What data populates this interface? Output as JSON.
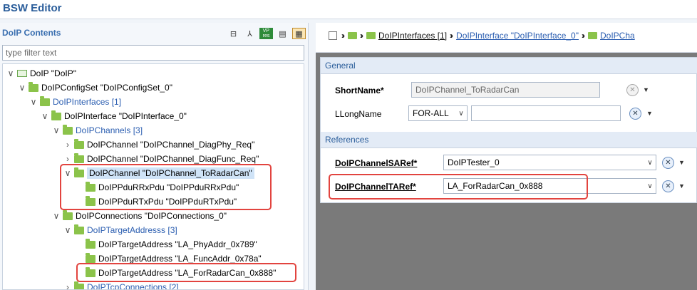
{
  "app": {
    "title": "BSW Editor"
  },
  "left": {
    "header": "DoIP Contents",
    "filter_placeholder": "type filter text",
    "tree": [
      {
        "label": "DoIP \"DoIP\"",
        "link": false
      },
      {
        "label": "DoIPConfigSet \"DoIPConfigSet_0\"",
        "link": false
      },
      {
        "label": "DoIPInterfaces [1]",
        "link": true
      },
      {
        "label": "DoIPInterface \"DoIPInterface_0\"",
        "link": false
      },
      {
        "label": "DoIPChannels [3]",
        "link": true
      },
      {
        "label": "DoIPChannel \"DoIPChannel_DiagPhy_Req\"",
        "link": false
      },
      {
        "label": "DoIPChannel \"DoIPChannel_DiagFunc_Req\"",
        "link": false
      },
      {
        "label": "DoIPChannel \"DoIPChannel_ToRadarCan\"",
        "link": false
      },
      {
        "label": "DoIPPduRRxPdu \"DoIPPduRRxPdu\"",
        "link": false
      },
      {
        "label": "DoIPPduRTxPdu \"DoIPPduRTxPdu\"",
        "link": false
      },
      {
        "label": "DoIPConnections \"DoIPConnections_0\"",
        "link": false
      },
      {
        "label": "DoIPTargetAddresss [3]",
        "link": true
      },
      {
        "label": "DoIPTargetAddress \"LA_PhyAddr_0x789\"",
        "link": false
      },
      {
        "label": "DoIPTargetAddress \"LA_FuncAddr_0x78a\"",
        "link": false
      },
      {
        "label": "DoIPTargetAddress \"LA_ForRadarCan_0x888\"",
        "link": false
      },
      {
        "label": "DoIPTcpConnections [2]",
        "link": true
      }
    ]
  },
  "breadcrumb": {
    "items": [
      "DoIPInterfaces [1]",
      "DoIPInterface \"DoIPInterface_0\"",
      "DoIPCha"
    ]
  },
  "editor": {
    "general": {
      "title": "General",
      "shortname_label": "ShortName*",
      "shortname_value": "DoIPChannel_ToRadarCan",
      "longname_label": "LLongName",
      "longname_lang": "FOR-ALL",
      "longname_value": ""
    },
    "references": {
      "title": "References",
      "sa_label": "DoIPChannelSARef*",
      "sa_value": "DoIPTester_0",
      "ta_label": "DoIPChannelTARef*",
      "ta_value": "LA_ForRadarCan_0x888"
    }
  }
}
